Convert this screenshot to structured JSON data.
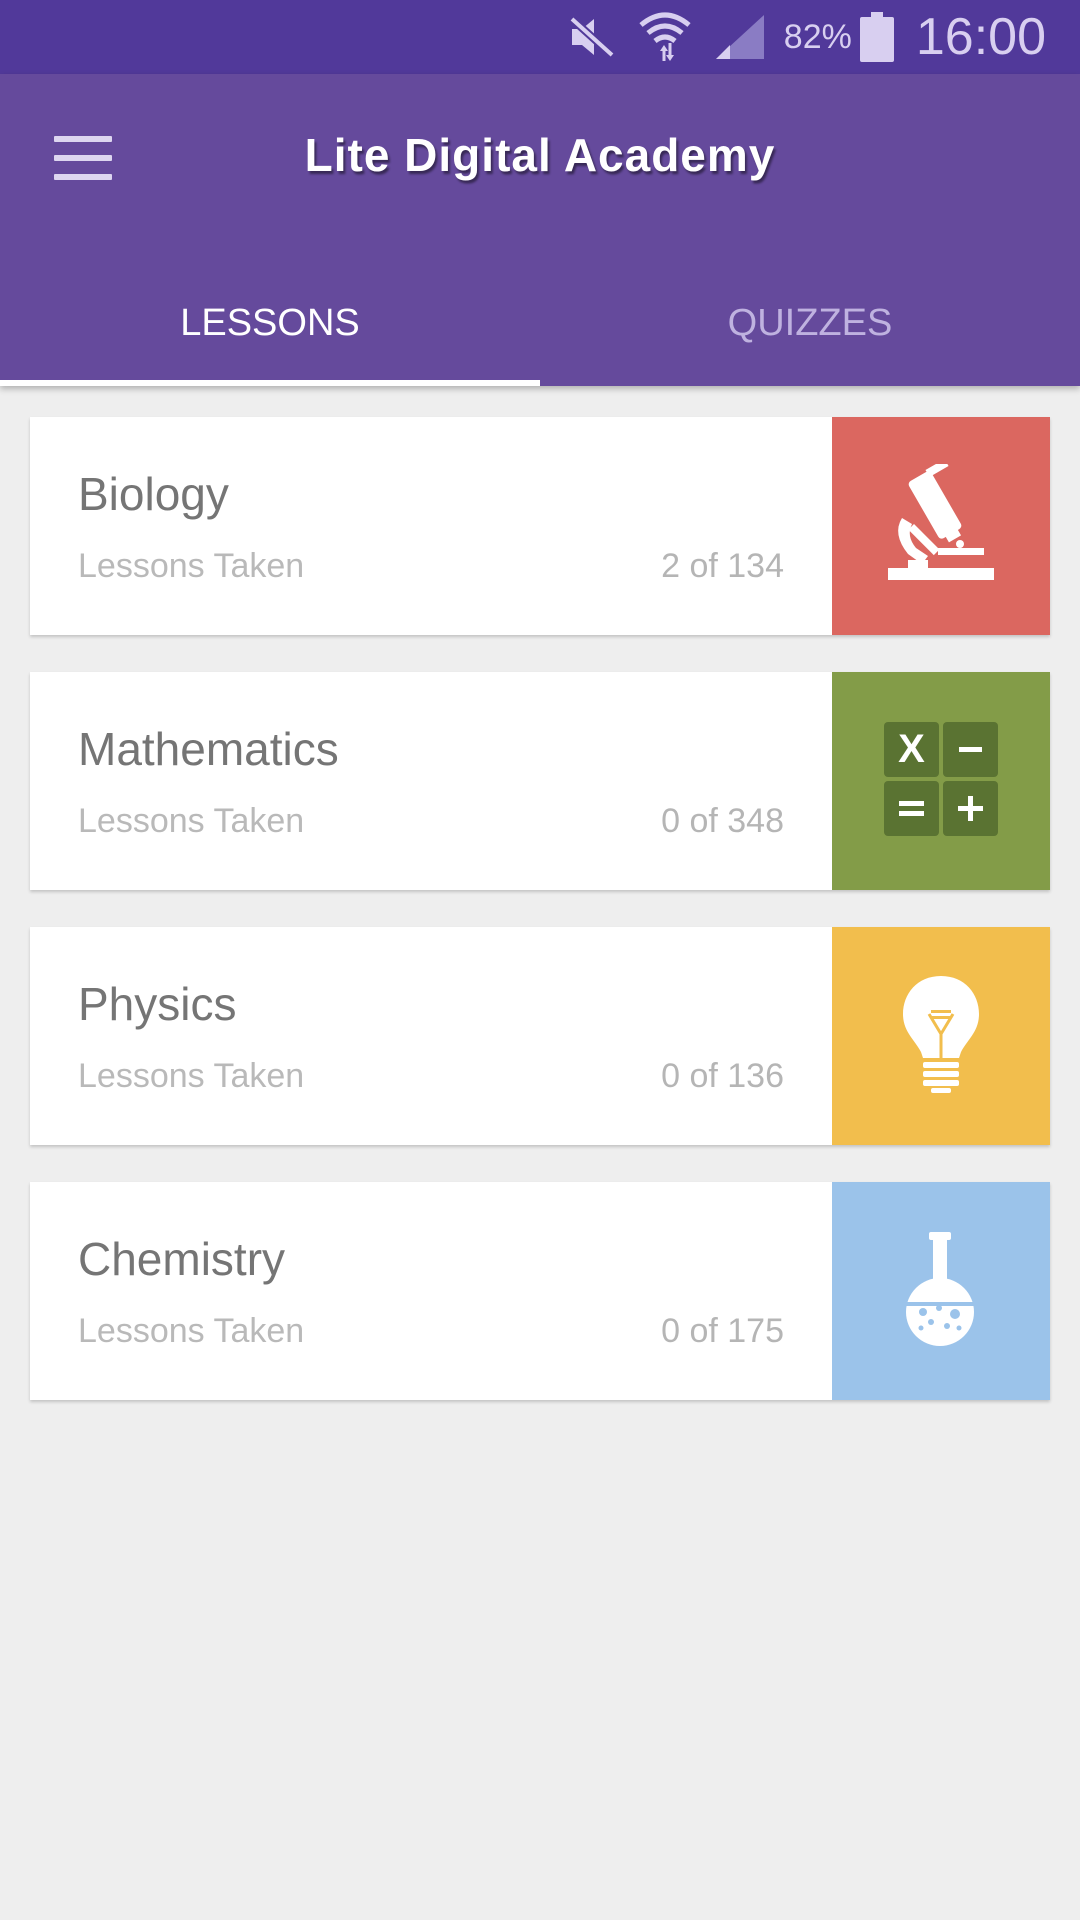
{
  "status_bar": {
    "battery_percent": "82%",
    "time": "16:00",
    "icons": [
      "mute-icon",
      "wifi-icon",
      "signal-icon",
      "battery-icon"
    ]
  },
  "app_bar": {
    "title": "Lite Digital Academy",
    "menu_icon": "hamburger-menu-icon",
    "background_color": "#654a9c"
  },
  "tabs": [
    {
      "label": "LESSONS",
      "active": true
    },
    {
      "label": "QUIZZES",
      "active": false
    }
  ],
  "courses": [
    {
      "name": "Biology",
      "lessons_label": "Lessons Taken",
      "progress": "2 of 134",
      "tile_color": "#db6760",
      "icon": "microscope-icon"
    },
    {
      "name": "Mathematics",
      "lessons_label": "Lessons Taken",
      "progress": "0 of 348",
      "tile_color": "#839c48",
      "icon": "calculator-icon"
    },
    {
      "name": "Physics",
      "lessons_label": "Lessons Taken",
      "progress": "0 of 136",
      "tile_color": "#f2be4d",
      "icon": "lightbulb-icon"
    },
    {
      "name": "Chemistry",
      "lessons_label": "Lessons Taken",
      "progress": "0 of 175",
      "tile_color": "#9bc3ea",
      "icon": "flask-icon"
    }
  ],
  "math_symbols": [
    "X",
    "−",
    "=",
    "+"
  ]
}
